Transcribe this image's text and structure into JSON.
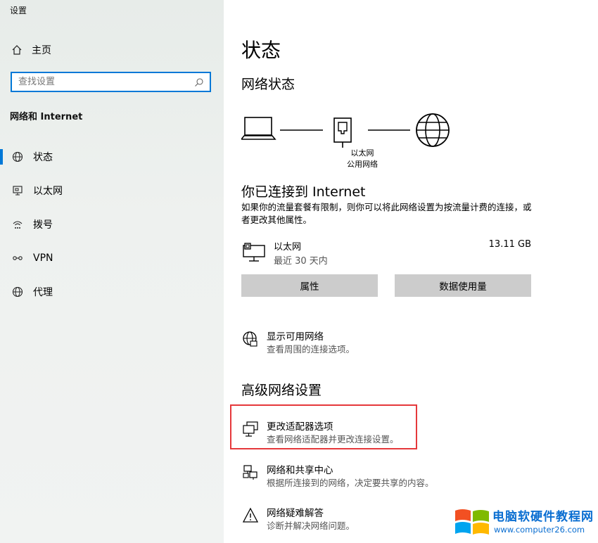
{
  "window": {
    "title": "设置"
  },
  "sidebar": {
    "home_label": "主页",
    "search_placeholder": "查找设置",
    "section_label": "网络和 Internet",
    "items": [
      {
        "label": "状态",
        "icon": "globe-status-icon",
        "active": true
      },
      {
        "label": "以太网",
        "icon": "ethernet-icon",
        "active": false
      },
      {
        "label": "拨号",
        "icon": "dialup-icon",
        "active": false
      },
      {
        "label": "VPN",
        "icon": "vpn-icon",
        "active": false
      },
      {
        "label": "代理",
        "icon": "globe-icon",
        "active": false
      }
    ],
    "accent_color": "#0078d7"
  },
  "main": {
    "title": "状态",
    "network_status_title": "网络状态",
    "diagram": {
      "label_line1": "以太网",
      "label_line2": "公用网络"
    },
    "connected_title": "你已连接到 Internet",
    "description": "如果你的流量套餐有限制，则你可以将此网络设置为按流量计费的连接，或者更改其他属性。",
    "connection": {
      "name": "以太网",
      "period": "最近 30 天内",
      "usage": "13.11 GB"
    },
    "buttons": {
      "properties": "属性",
      "data_usage": "数据使用量"
    },
    "show_networks": {
      "title": "显示可用网络",
      "subtitle": "查看周围的连接选项。"
    },
    "advanced_title": "高级网络设置",
    "advanced_items": [
      {
        "title": "更改适配器选项",
        "subtitle": "查看网络适配器并更改连接设置。",
        "icon": "adapter-icon"
      },
      {
        "title": "网络和共享中心",
        "subtitle": "根据所连接到的网络，决定要共享的内容。",
        "icon": "sharing-center-icon"
      },
      {
        "title": "网络疑难解答",
        "subtitle": "诊断并解决网络问题。",
        "icon": "warning-icon"
      }
    ],
    "highlight_color": "#e5383b"
  },
  "watermark": {
    "text": "电脑软硬件教程网",
    "url": "www.computer26.com"
  }
}
